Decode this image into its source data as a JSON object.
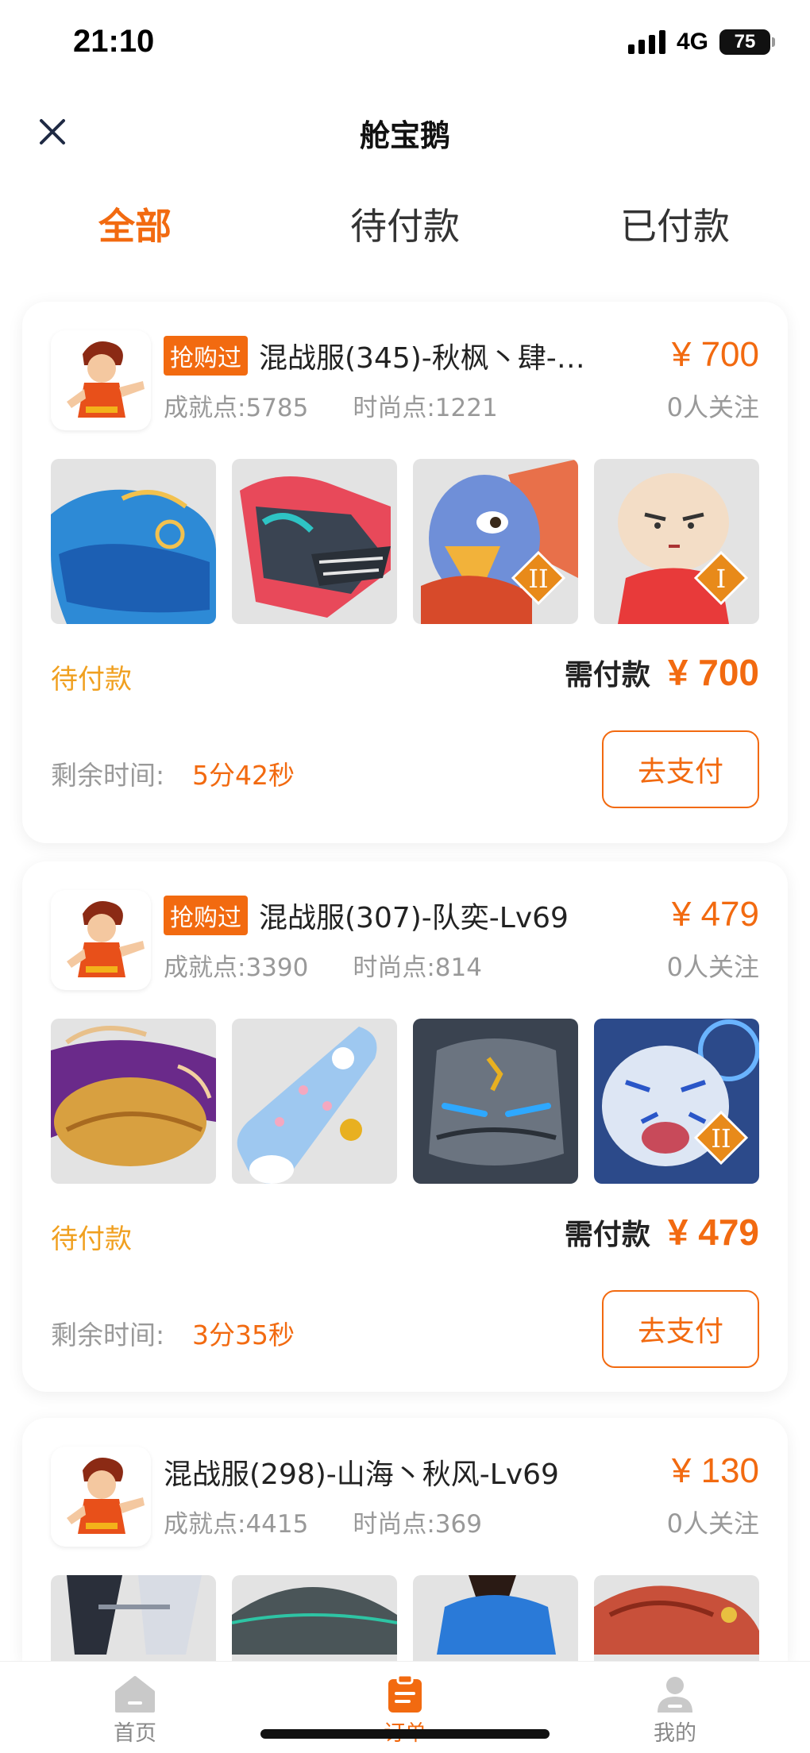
{
  "status_bar": {
    "time": "21:10",
    "network": "4G",
    "battery": "75"
  },
  "header": {
    "title": "舱宝鹅"
  },
  "tabs": [
    {
      "label": "全部",
      "active": true
    },
    {
      "label": "待付款",
      "active": false
    },
    {
      "label": "已付款",
      "active": false
    }
  ],
  "orders": [
    {
      "badge": "抢购过",
      "title": "混战服(345)-秋枫丶肆-…",
      "price": "¥ 700",
      "achievement": "成就点:5785",
      "fashion": "时尚点:1221",
      "followers": "0人关注",
      "thumbs": [
        "whale-mount",
        "mech-wolf",
        "eagle-rank-II",
        "bun-character-rank-I"
      ],
      "status": "待付款",
      "need_pay_label": "需付款",
      "need_pay_amount": "¥ 700",
      "timer_label": "剩余时间:",
      "timer_value": "5分42秒",
      "pay_label": "去支付"
    },
    {
      "badge": "抢购过",
      "title": "混战服(307)-队奕-Lv69",
      "price": "¥ 479",
      "achievement": "成就点:3390",
      "fashion": "时尚点:814",
      "followers": "0人关注",
      "thumbs": [
        "purple-whale",
        "skateboard",
        "stone-golem",
        "white-tiger-rank-II"
      ],
      "status": "待付款",
      "need_pay_label": "需付款",
      "need_pay_amount": "¥ 479",
      "timer_label": "剩余时间:",
      "timer_value": "3分35秒",
      "pay_label": "去支付"
    },
    {
      "title": "混战服(298)-山海丶秋风-Lv69",
      "price": "¥ 130",
      "achievement": "成就点:4415",
      "fashion": "时尚点:369",
      "followers": "0人关注",
      "thumbs": [
        "silver-armor",
        "grey-hat",
        "blue-hat",
        "red-dragon"
      ]
    }
  ],
  "tabbar": [
    {
      "label": "首页",
      "icon": "home-icon",
      "active": false
    },
    {
      "label": "订单",
      "icon": "order-icon",
      "active": true
    },
    {
      "label": "我的",
      "icon": "profile-icon",
      "active": false
    }
  ],
  "colors": {
    "accent": "#f26a10",
    "pending": "#f0a020",
    "muted": "#999999"
  }
}
